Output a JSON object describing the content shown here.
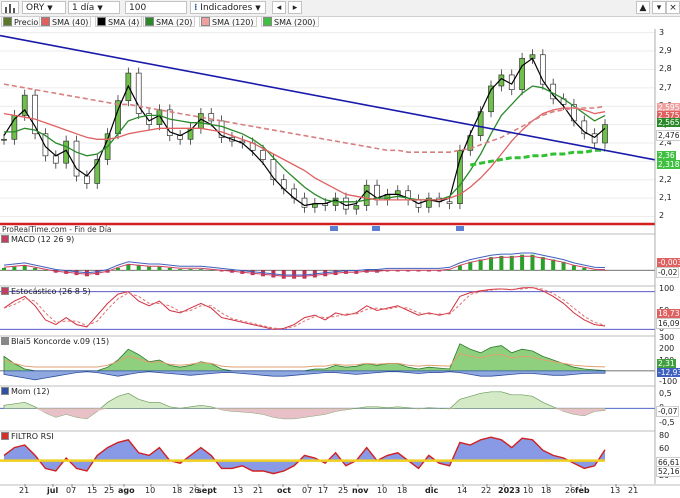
{
  "toolbar": {
    "symbol": "ORY",
    "interval": "1 día",
    "units": "100 unidades",
    "indicators": "Indicadores",
    "icons": [
      "bar-chart-icon",
      "arrow-left-icon",
      "arrow-right-icon",
      "chevron-up-icon",
      "chevron-down-icon",
      "expand-icon",
      "close-icon"
    ]
  },
  "legend": [
    {
      "label": "Precio",
      "color": "#5a7a2a"
    },
    {
      "label": "SMA (40)",
      "color": "#e06060"
    },
    {
      "label": "SMA (4)",
      "color": "#000000"
    },
    {
      "label": "SMA (20)",
      "color": "#2a8a2a"
    },
    {
      "label": "SMA (120)",
      "color": "#f0a0a0"
    },
    {
      "label": "SMA (200)",
      "color": "#40c040"
    }
  ],
  "main_panel": {
    "yticks": [
      "3",
      "2,9",
      "2,8",
      "2,7",
      "2,6",
      "2,5",
      "2,4",
      "2,3",
      "2,2",
      "2,1",
      "2"
    ],
    "tags": [
      {
        "text": "2,595",
        "color": "#f0a0a0"
      },
      {
        "text": "2,575",
        "color": "#e06060"
      },
      {
        "text": "2,565",
        "color": "#2a8a2a"
      },
      {
        "text": "2,476",
        "color": "#ffffff"
      },
      {
        "text": "2,36",
        "color": "#40c040"
      },
      {
        "text": "2,318",
        "color": "#40c040"
      }
    ],
    "copyright": "ProRealTime.com - Fin de Día"
  },
  "subpanels": [
    {
      "key": "macd",
      "title": "MACD (12 26 9)",
      "color": "#c04060",
      "yticks": [
        "0"
      ],
      "tags": [
        {
          "text": "-0,003",
          "color": "#e06060"
        },
        {
          "text": "-0,02",
          "color": "#ffffff"
        }
      ]
    },
    {
      "key": "stoch",
      "title": "Estocástico (26 8 5)",
      "color": "#c04060",
      "yticks": [
        "100",
        "50",
        "0"
      ],
      "tags": [
        {
          "text": "18,73",
          "color": "#e06060"
        },
        {
          "text": "16,09",
          "color": "#ffffff"
        }
      ]
    },
    {
      "key": "blai",
      "title": "Blai5 Koncorde v.09 (15)",
      "color": "#888888",
      "yticks": [
        "300",
        "200",
        "100",
        "0",
        "-100"
      ],
      "tags": [
        {
          "text": "2,31",
          "color": "#40a040"
        },
        {
          "text": "-12,93",
          "color": "#4060c0"
        }
      ]
    },
    {
      "key": "mom",
      "title": "Mom (12)",
      "color": "#3050a0",
      "yticks": [
        "0,5",
        "0",
        "-0,07",
        "-0,5"
      ],
      "tags": [
        {
          "text": "-0,07",
          "color": "#ffffff"
        }
      ]
    },
    {
      "key": "rsi",
      "title": "FILTRO RSI",
      "color": "#d03030",
      "yticks": [
        "80",
        "60",
        "40",
        "20"
      ],
      "tags": [
        {
          "text": "66,61",
          "color": "#ffffff"
        },
        {
          "text": "52,16",
          "color": "#ffffff"
        }
      ]
    }
  ],
  "xaxis": [
    {
      "label": "21",
      "bold": false
    },
    {
      "label": "jul",
      "bold": true
    },
    {
      "label": "07",
      "bold": false
    },
    {
      "label": "15",
      "bold": false
    },
    {
      "label": "25",
      "bold": false
    },
    {
      "label": "ago",
      "bold": true
    },
    {
      "label": "10",
      "bold": false
    },
    {
      "label": "18",
      "bold": false
    },
    {
      "label": "26",
      "bold": false
    },
    {
      "label": "sept",
      "bold": true
    },
    {
      "label": "13",
      "bold": false
    },
    {
      "label": "21",
      "bold": false
    },
    {
      "label": "oct",
      "bold": true
    },
    {
      "label": "07",
      "bold": false
    },
    {
      "label": "17",
      "bold": false
    },
    {
      "label": "25",
      "bold": false
    },
    {
      "label": "nov",
      "bold": true
    },
    {
      "label": "10",
      "bold": false
    },
    {
      "label": "18",
      "bold": false
    },
    {
      "label": "dic",
      "bold": true
    },
    {
      "label": "14",
      "bold": false
    },
    {
      "label": "22",
      "bold": false
    },
    {
      "label": "2023",
      "bold": true
    },
    {
      "label": "10",
      "bold": false
    },
    {
      "label": "18",
      "bold": false
    },
    {
      "label": "26",
      "bold": false
    },
    {
      "label": "feb",
      "bold": true
    },
    {
      "label": "13",
      "bold": false
    },
    {
      "label": "21",
      "bold": false
    }
  ],
  "chart_data": {
    "type": "line",
    "title": "",
    "series": [
      {
        "name": "Precio",
        "values": [
          2.42,
          2.55,
          2.66,
          2.45,
          2.33,
          2.29,
          2.41,
          2.22,
          2.18,
          2.31,
          2.45,
          2.63,
          2.78,
          2.56,
          2.5,
          2.58,
          2.44,
          2.42,
          2.48,
          2.56,
          2.52,
          2.43,
          2.41,
          2.4,
          2.36,
          2.31,
          2.2,
          2.15,
          2.1,
          2.05,
          2.07,
          2.06,
          2.1,
          2.04,
          2.06,
          2.17,
          2.09,
          2.12,
          2.14,
          2.09,
          2.05,
          2.1,
          2.08,
          2.07,
          2.36,
          2.44,
          2.57,
          2.71,
          2.77,
          2.69,
          2.86,
          2.88,
          2.72,
          2.64,
          2.61,
          2.52,
          2.45,
          2.4,
          2.5
        ]
      },
      {
        "name": "SMA (4)",
        "values": [
          2.44,
          2.53,
          2.58,
          2.49,
          2.38,
          2.33,
          2.36,
          2.26,
          2.22,
          2.29,
          2.42,
          2.58,
          2.71,
          2.6,
          2.52,
          2.55,
          2.46,
          2.44,
          2.47,
          2.53,
          2.5,
          2.44,
          2.42,
          2.4,
          2.35,
          2.29,
          2.21,
          2.15,
          2.1,
          2.06,
          2.07,
          2.07,
          2.09,
          2.06,
          2.07,
          2.14,
          2.1,
          2.12,
          2.12,
          2.1,
          2.07,
          2.09,
          2.08,
          2.1,
          2.31,
          2.45,
          2.57,
          2.69,
          2.75,
          2.72,
          2.82,
          2.86,
          2.74,
          2.66,
          2.6,
          2.52,
          2.46,
          2.43,
          2.48
        ]
      },
      {
        "name": "SMA (20)",
        "values": [
          2.46,
          2.46,
          2.48,
          2.47,
          2.44,
          2.4,
          2.38,
          2.35,
          2.33,
          2.34,
          2.38,
          2.45,
          2.52,
          2.54,
          2.55,
          2.55,
          2.53,
          2.52,
          2.51,
          2.51,
          2.5,
          2.49,
          2.47,
          2.45,
          2.42,
          2.38,
          2.32,
          2.26,
          2.21,
          2.16,
          2.12,
          2.09,
          2.08,
          2.08,
          2.08,
          2.09,
          2.1,
          2.1,
          2.11,
          2.1,
          2.09,
          2.09,
          2.09,
          2.11,
          2.17,
          2.25,
          2.34,
          2.45,
          2.55,
          2.61,
          2.67,
          2.71,
          2.7,
          2.67,
          2.64,
          2.6,
          2.56,
          2.52,
          2.55
        ]
      },
      {
        "name": "SMA (40)",
        "values": [
          2.56,
          2.55,
          2.54,
          2.53,
          2.51,
          2.49,
          2.47,
          2.45,
          2.43,
          2.42,
          2.42,
          2.43,
          2.45,
          2.46,
          2.47,
          2.48,
          2.48,
          2.48,
          2.48,
          2.48,
          2.47,
          2.46,
          2.44,
          2.42,
          2.4,
          2.37,
          2.34,
          2.31,
          2.28,
          2.25,
          2.21,
          2.18,
          2.15,
          2.12,
          2.11,
          2.1,
          2.09,
          2.09,
          2.09,
          2.09,
          2.09,
          2.09,
          2.09,
          2.1,
          2.12,
          2.16,
          2.21,
          2.27,
          2.34,
          2.41,
          2.47,
          2.52,
          2.56,
          2.58,
          2.59,
          2.59,
          2.58,
          2.56,
          2.57
        ]
      },
      {
        "name": "SMA (120)",
        "values": [
          2.72,
          2.71,
          2.7,
          2.69,
          2.68,
          2.67,
          2.66,
          2.65,
          2.64,
          2.63,
          2.62,
          2.61,
          2.61,
          2.6,
          2.59,
          2.58,
          2.57,
          2.56,
          2.55,
          2.54,
          2.53,
          2.52,
          2.51,
          2.5,
          2.49,
          2.48,
          2.47,
          2.46,
          2.45,
          2.44,
          2.43,
          2.42,
          2.41,
          2.4,
          2.39,
          2.38,
          2.37,
          2.36,
          2.36,
          2.35,
          2.35,
          2.35,
          2.35,
          2.35,
          2.36,
          2.37,
          2.39,
          2.41,
          2.43,
          2.46,
          2.49,
          2.52,
          2.55,
          2.57,
          2.58,
          2.59,
          2.59,
          2.59,
          2.6
        ]
      },
      {
        "name": "SMA (200)",
        "values": [
          null,
          null,
          null,
          null,
          null,
          null,
          null,
          null,
          null,
          null,
          null,
          null,
          null,
          null,
          null,
          null,
          null,
          null,
          null,
          null,
          null,
          null,
          null,
          null,
          null,
          null,
          null,
          null,
          null,
          null,
          null,
          null,
          null,
          null,
          null,
          null,
          null,
          null,
          null,
          null,
          null,
          null,
          null,
          null,
          null,
          2.28,
          2.29,
          2.3,
          2.31,
          2.32,
          2.32,
          2.33,
          2.33,
          2.34,
          2.34,
          2.35,
          2.35,
          2.36,
          2.36
        ]
      }
    ],
    "trendline": [
      [
        0,
        2.98
      ],
      [
        58,
        2.36
      ]
    ],
    "ylim": [
      1.97,
      3.02
    ],
    "grid": true
  },
  "sub_data": {
    "macd_hist": [
      0.02,
      0.03,
      0.04,
      0.02,
      0.0,
      -0.02,
      -0.03,
      -0.04,
      -0.05,
      -0.04,
      -0.02,
      0.02,
      0.05,
      0.04,
      0.03,
      0.03,
      0.02,
      0.01,
      0.01,
      0.01,
      0.0,
      -0.01,
      -0.02,
      -0.03,
      -0.04,
      -0.05,
      -0.06,
      -0.07,
      -0.07,
      -0.07,
      -0.06,
      -0.05,
      -0.04,
      -0.03,
      -0.03,
      -0.02,
      -0.02,
      -0.01,
      -0.01,
      -0.01,
      -0.01,
      -0.01,
      -0.01,
      0.0,
      0.04,
      0.07,
      0.09,
      0.11,
      0.12,
      0.12,
      0.13,
      0.13,
      0.11,
      0.09,
      0.07,
      0.04,
      0.02,
      0.0,
      -0.003
    ],
    "stoch": [
      55,
      70,
      80,
      60,
      30,
      20,
      35,
      20,
      15,
      40,
      65,
      85,
      90,
      70,
      60,
      70,
      50,
      45,
      55,
      65,
      55,
      35,
      30,
      25,
      20,
      15,
      10,
      12,
      20,
      35,
      40,
      30,
      45,
      40,
      45,
      60,
      50,
      55,
      60,
      50,
      40,
      45,
      40,
      45,
      80,
      88,
      92,
      95,
      96,
      94,
      98,
      99,
      92,
      80,
      65,
      45,
      30,
      20,
      17
    ],
    "blai_green": [
      80,
      40,
      10,
      0,
      0,
      0,
      0,
      0,
      0,
      0,
      20,
      60,
      120,
      90,
      50,
      60,
      30,
      20,
      30,
      50,
      40,
      10,
      0,
      0,
      0,
      0,
      0,
      0,
      0,
      0,
      10,
      10,
      30,
      20,
      25,
      40,
      30,
      40,
      40,
      20,
      10,
      20,
      15,
      10,
      150,
      120,
      100,
      130,
      140,
      100,
      120,
      110,
      80,
      60,
      40,
      20,
      10,
      5,
      2
    ],
    "blai_blue": [
      -20,
      -30,
      -40,
      -50,
      -40,
      -30,
      -20,
      -10,
      -5,
      -10,
      -20,
      -30,
      -20,
      -10,
      -5,
      -10,
      -15,
      -20,
      -25,
      -20,
      -15,
      -10,
      -10,
      -15,
      -20,
      -25,
      -30,
      -30,
      -25,
      -20,
      -15,
      -10,
      -10,
      -15,
      -20,
      -15,
      -10,
      -5,
      -5,
      -10,
      -15,
      -10,
      -10,
      -5,
      -10,
      -20,
      -30,
      -30,
      -25,
      -20,
      -15,
      -15,
      -20,
      -25,
      -25,
      -20,
      -15,
      -13,
      -13
    ],
    "mom": [
      0.1,
      0.15,
      0.2,
      0.05,
      -0.15,
      -0.3,
      -0.2,
      -0.3,
      -0.35,
      -0.1,
      0.2,
      0.4,
      0.5,
      0.3,
      0.2,
      0.2,
      0.05,
      0.0,
      0.05,
      0.1,
      0.05,
      -0.05,
      -0.1,
      -0.12,
      -0.15,
      -0.2,
      -0.3,
      -0.35,
      -0.35,
      -0.3,
      -0.25,
      -0.2,
      -0.1,
      -0.05,
      0.0,
      0.05,
      0.05,
      0.02,
      0.05,
      0.02,
      -0.02,
      0.02,
      0.0,
      -0.02,
      0.3,
      0.4,
      0.5,
      0.55,
      0.55,
      0.45,
      0.45,
      0.4,
      0.2,
      0.05,
      -0.1,
      -0.2,
      -0.25,
      -0.1,
      -0.07
    ],
    "rsi": [
      55,
      70,
      75,
      55,
      30,
      25,
      50,
      30,
      25,
      55,
      70,
      80,
      85,
      60,
      55,
      70,
      45,
      40,
      55,
      70,
      55,
      30,
      30,
      35,
      25,
      25,
      20,
      25,
      35,
      55,
      50,
      40,
      60,
      35,
      45,
      70,
      45,
      55,
      60,
      45,
      30,
      55,
      40,
      35,
      80,
      75,
      85,
      90,
      85,
      70,
      88,
      85,
      65,
      55,
      50,
      40,
      30,
      35,
      66
    ]
  }
}
